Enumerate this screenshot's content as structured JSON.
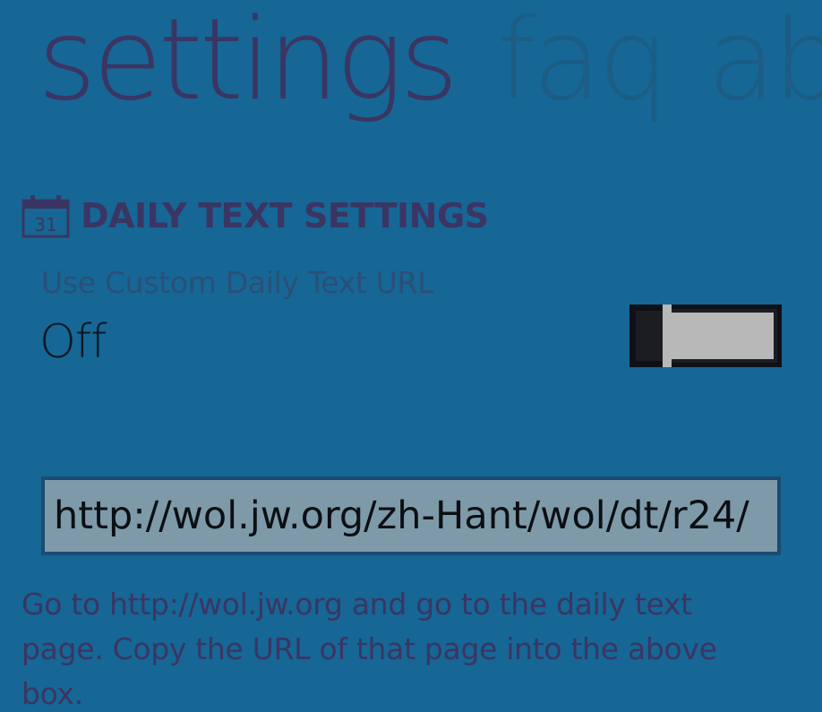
{
  "pivot": {
    "items": [
      {
        "label": "settings",
        "active": true
      },
      {
        "label": "faq",
        "active": false
      },
      {
        "label": "ab",
        "active": false
      }
    ]
  },
  "section": {
    "icon": "calendar-icon",
    "icon_day": "31",
    "title": "DAILY TEXT SETTINGS"
  },
  "custom_url_toggle": {
    "label": "Use Custom Daily Text URL",
    "state_text": "Off",
    "is_on": false
  },
  "url_field": {
    "value": "http://wol.jw.org/zh-Hant/wol/dt/r24/"
  },
  "help": {
    "text": "Go to http://wol.jw.org and go to the daily text page. Copy the URL of that page into the above box."
  },
  "colors": {
    "background": "#166795",
    "accent": "#3b3563",
    "input_background": "#7e9aa8"
  }
}
